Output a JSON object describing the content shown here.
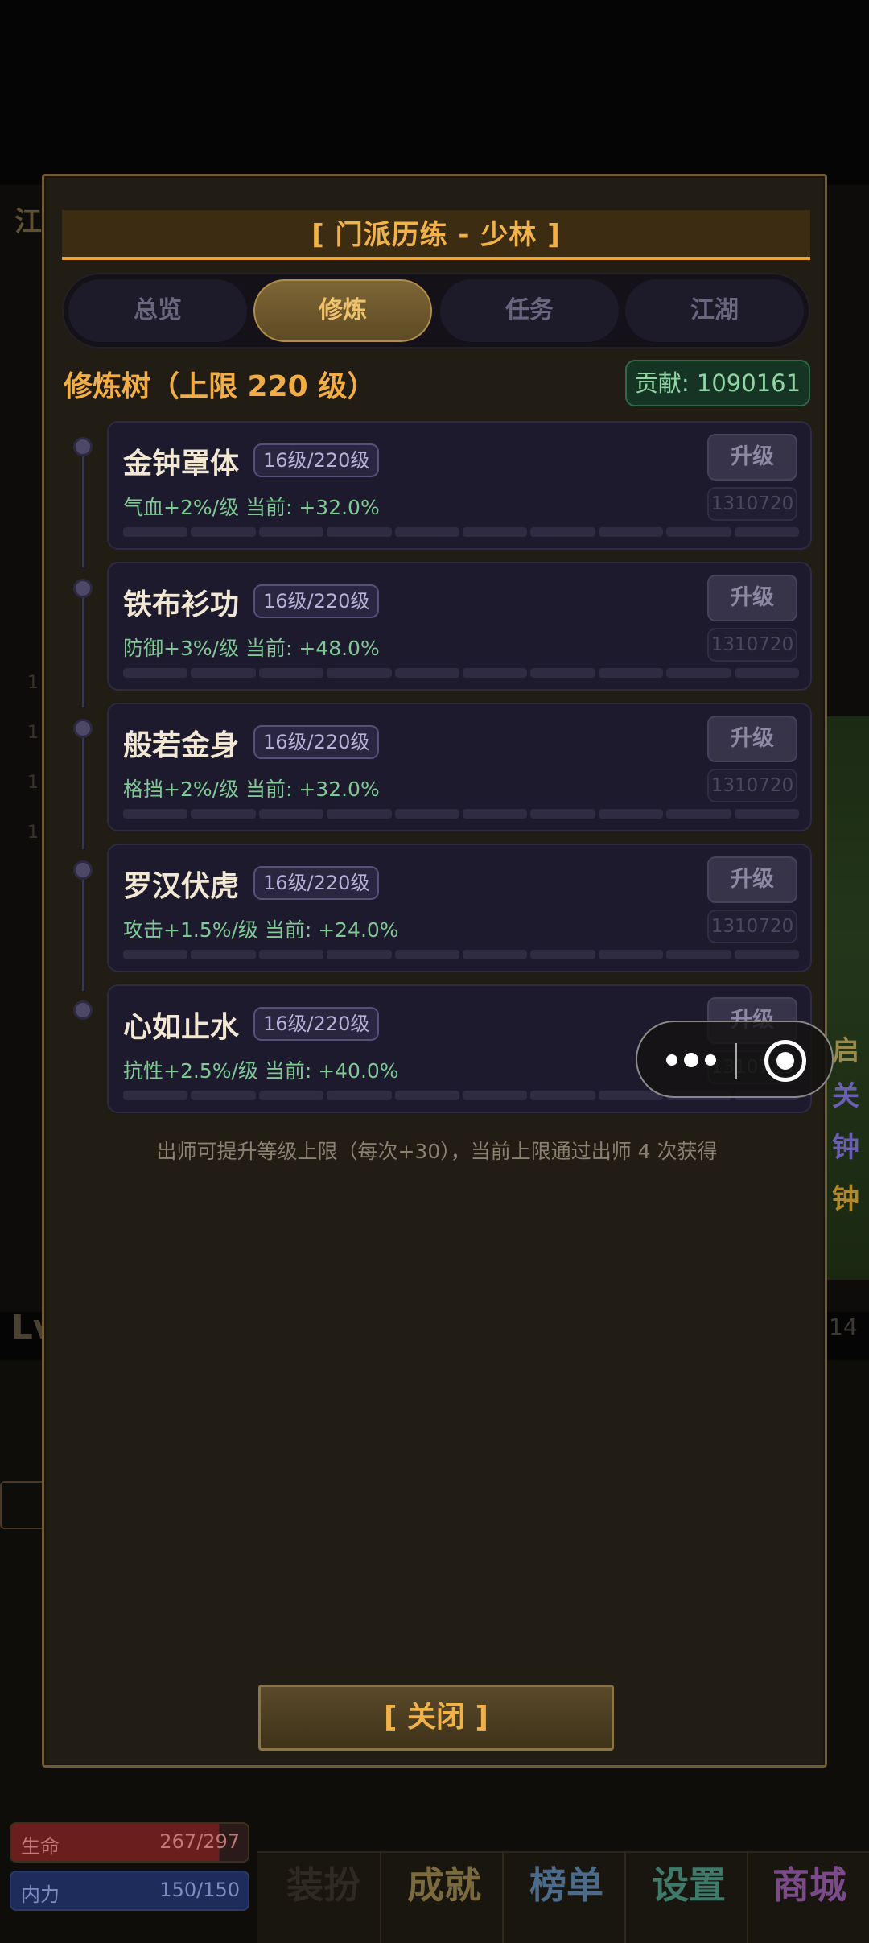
{
  "modal": {
    "title": "[ 门派历练 - 少林 ]",
    "tabs": [
      "总览",
      "修炼",
      "任务",
      "江湖"
    ],
    "active_tab": "修炼",
    "section_title": "修炼树（上限 220 级）",
    "contribution": "贡献: 1090161",
    "skills": [
      {
        "name": "金钟罩体",
        "level": "16级/220级",
        "desc": "气血+2%/级  当前: +32.0%",
        "button": "升级",
        "cost": "1310720"
      },
      {
        "name": "铁布衫功",
        "level": "16级/220级",
        "desc": "防御+3%/级  当前: +48.0%",
        "button": "升级",
        "cost": "1310720"
      },
      {
        "name": "般若金身",
        "level": "16级/220级",
        "desc": "格挡+2%/级  当前: +32.0%",
        "button": "升级",
        "cost": "1310720"
      },
      {
        "name": "罗汉伏虎",
        "level": "16级/220级",
        "desc": "攻击+1.5%/级  当前: +24.0%",
        "button": "升级",
        "cost": "1310720"
      },
      {
        "name": "心如止水",
        "level": "16级/220级",
        "desc": "抗性+2.5%/级  当前: +40.0%",
        "button": "升级",
        "cost": "1310720"
      }
    ],
    "note": "出师可提升等级上限（每次+30），当前上限通过出师 4 次获得",
    "close_label": "[ 关闭 ]"
  },
  "background": {
    "top_left_char": "江",
    "level_label": "Lv",
    "level_right": "14",
    "hp_label": "生命",
    "hp_value": "267/297",
    "mp_label": "内力",
    "mp_value": "150/150",
    "bottom_nav": [
      "装扮",
      "成就",
      "榜单",
      "设置",
      "商城"
    ],
    "side_chars": [
      "启",
      "关",
      "钟",
      "钟"
    ]
  },
  "colors": {
    "accent": "#f2b24a",
    "tab_active": "#f0c26c",
    "green_text": "#7fc995",
    "contribution_bg": "#163424"
  }
}
